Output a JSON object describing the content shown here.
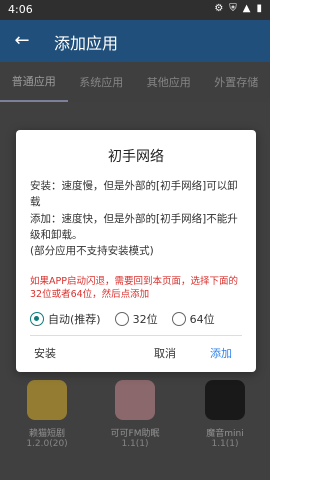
{
  "status_bar": {
    "time": "4:06",
    "icons": [
      "settings-icon",
      "shield-icon",
      "wifi-icon",
      "battery-icon"
    ]
  },
  "appbar": {
    "title": "添加应用"
  },
  "tabs": [
    "普通应用",
    "系统应用",
    "其他应用",
    "外置存储"
  ],
  "apps": [
    {
      "name": "赖猫短剧",
      "version": "1.2.0(20)"
    },
    {
      "name": "可可FM助眠",
      "version": "1.1(1)"
    },
    {
      "name": "魔音mini",
      "version": "1.1(1)"
    }
  ],
  "dialog": {
    "title": "初手网络",
    "install_text": "安装：速度慢，但是外部的[初手网络]可以卸载",
    "add_text": "添加：速度快，但是外部的[初手网络]不能升级和卸载。",
    "note": "(部分应用不支持安装模式)",
    "warning": "如果APP启动闪退，需要回到本页面，选择下面的32位或者64位，然后点添加",
    "radio": {
      "auto": "自动(推荐)",
      "b32": "32位",
      "b64": "64位",
      "selected": "自动(推荐)"
    },
    "buttons": {
      "install": "安装",
      "cancel": "取消",
      "add": "添加"
    }
  },
  "colors": {
    "appbar": "#1f4f7a",
    "accent": "#0f7c7a",
    "warning": "#d9312e",
    "link": "#2f80ed"
  }
}
